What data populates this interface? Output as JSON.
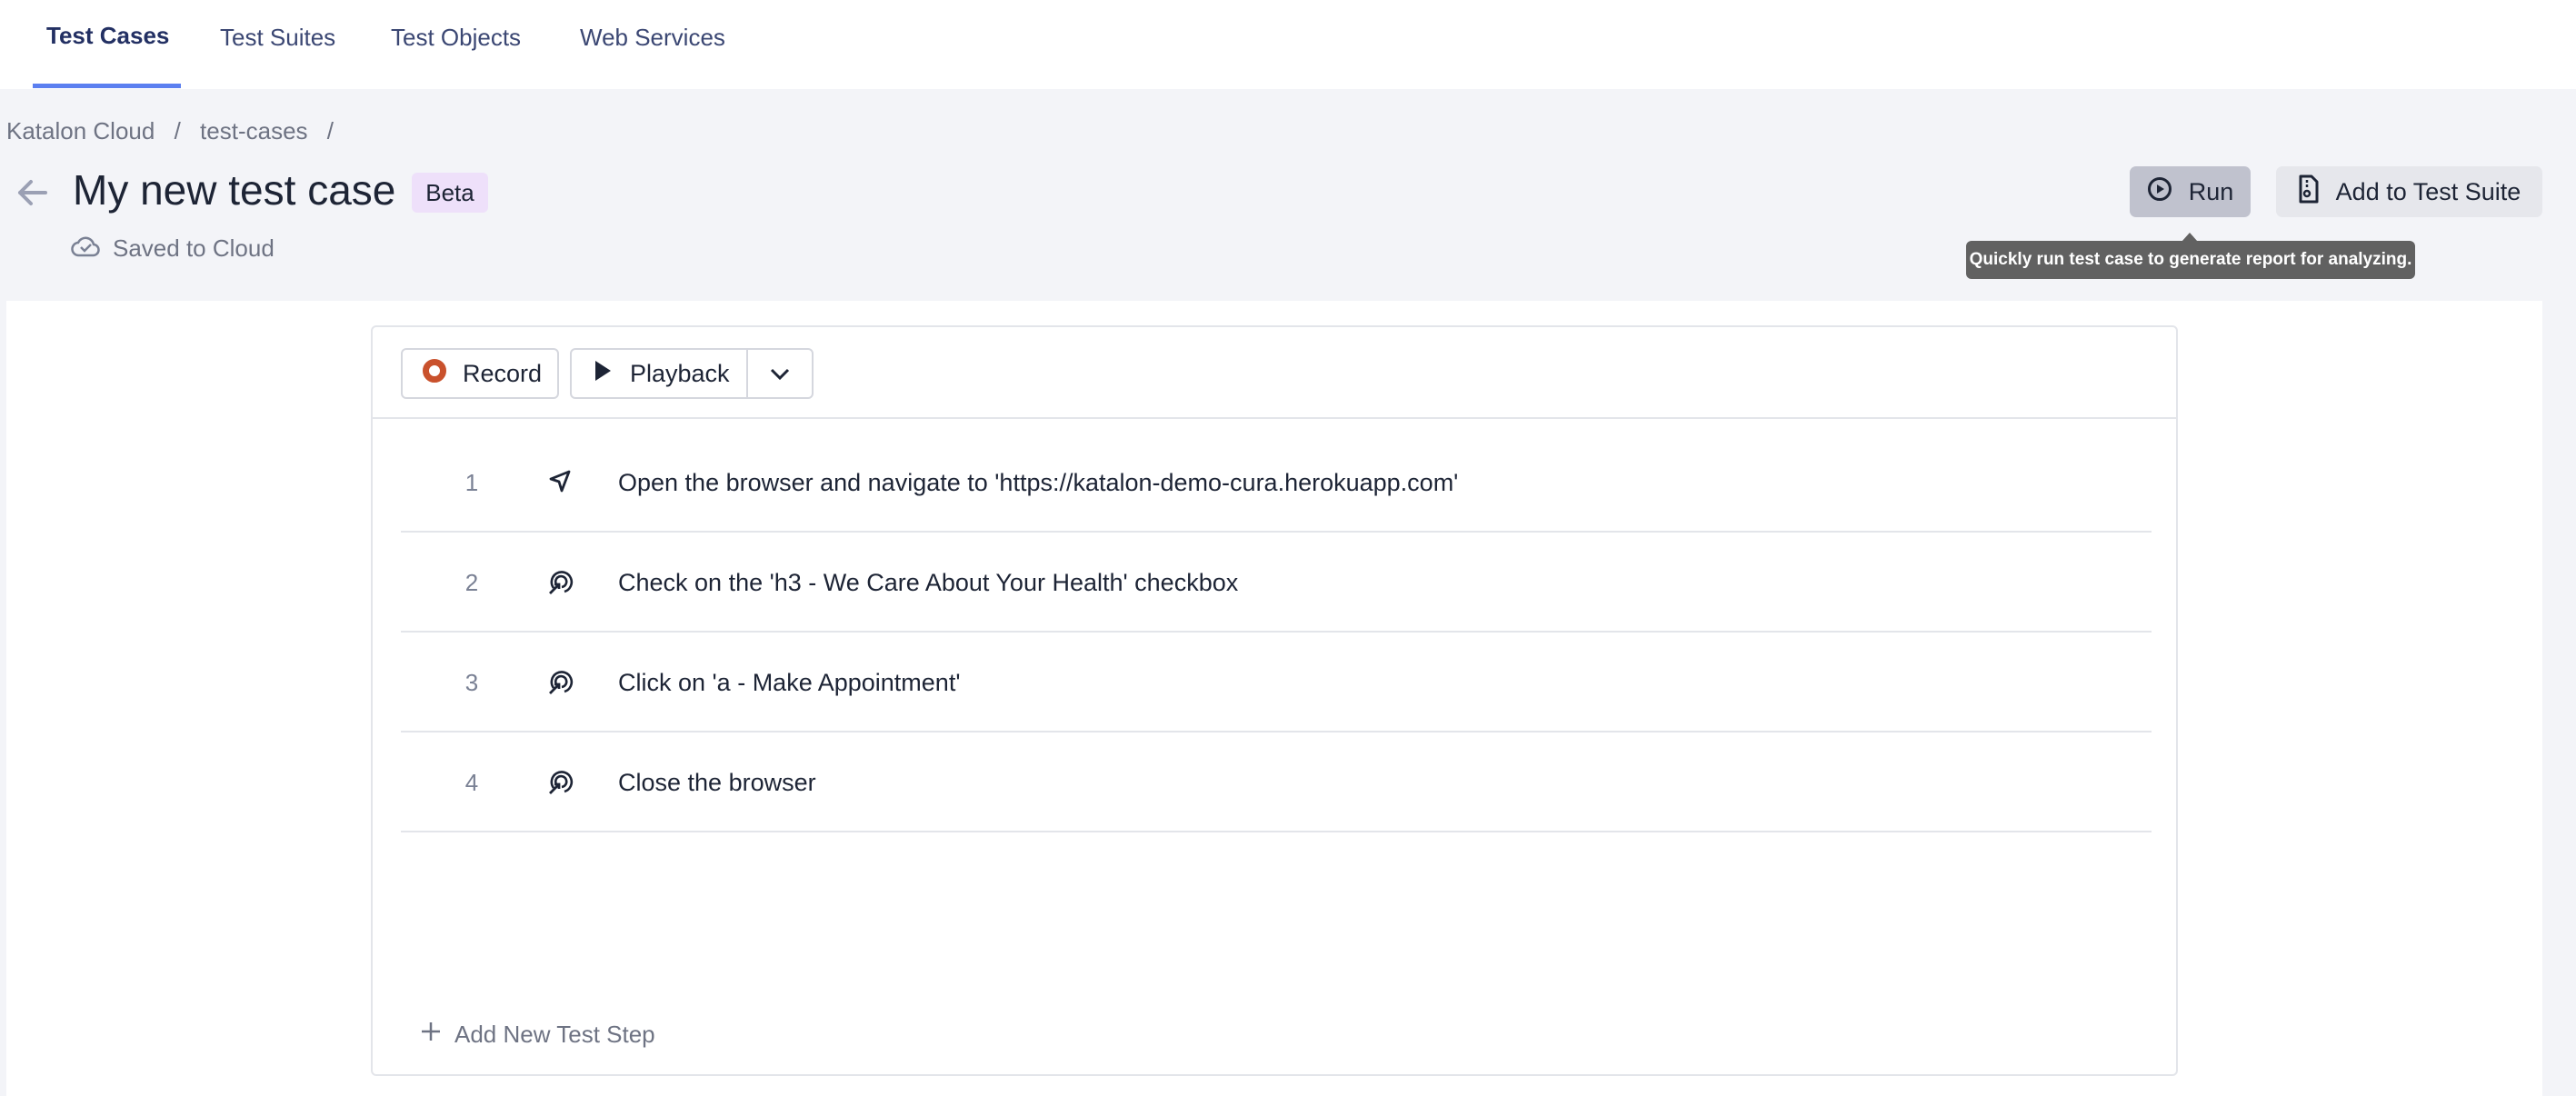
{
  "tabs": [
    {
      "label": "Test Cases",
      "active": true
    },
    {
      "label": "Test Suites",
      "active": false
    },
    {
      "label": "Test Objects",
      "active": false
    },
    {
      "label": "Web Services",
      "active": false
    }
  ],
  "breadcrumb": [
    "Katalon Cloud",
    "/",
    "test-cases",
    "/"
  ],
  "header": {
    "title": "My new test case",
    "badge": "Beta",
    "save_status": "Saved to Cloud",
    "run_label": "Run",
    "add_suite_label": "Add to Test Suite",
    "run_tooltip": "Quickly run test case to generate report for analyzing."
  },
  "toolbar": {
    "record_label": "Record",
    "playback_label": "Playback"
  },
  "steps": [
    {
      "num": "1",
      "icon": "navigate-icon",
      "text": "Open the browser and navigate to 'https://katalon-demo-cura.herokuapp.com'"
    },
    {
      "num": "2",
      "icon": "click-target-icon",
      "text": "Check on the 'h3 - We Care About Your Health' checkbox"
    },
    {
      "num": "3",
      "icon": "click-target-icon",
      "text": "Click on 'a - Make Appointment'"
    },
    {
      "num": "4",
      "icon": "click-target-icon",
      "text": "Close the browser"
    }
  ],
  "add_step_label": "Add New Test Step",
  "colors": {
    "accent": "#5b7ff0",
    "record": "#c9512c",
    "badge_bg": "#eee0fa",
    "tooltip_bg": "#616161"
  }
}
